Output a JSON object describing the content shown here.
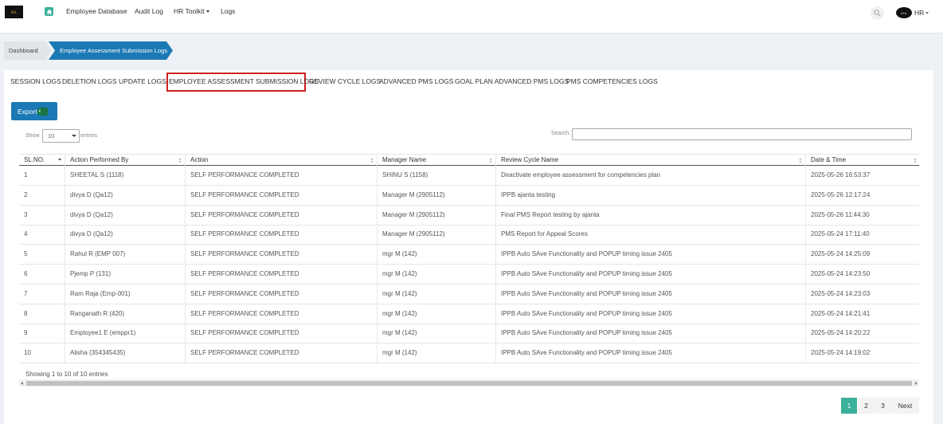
{
  "brand": {
    "logo_text": "EHL"
  },
  "nav": {
    "items": [
      "Employee Database",
      "Audit Log",
      "HR Toolkit",
      "Logs"
    ],
    "user_label": "HR",
    "avatar_text": "EHL"
  },
  "breadcrumb": {
    "home": "Dashboard",
    "current": "Employee Assessment Submission Logs"
  },
  "tabs": [
    "SESSION LOGS",
    "DELETION LOGS",
    "UPDATE LOGS",
    "EMPLOYEE ASSESSMENT SUBMISSION LOGS",
    "REVIEW CYCLE LOGS",
    "ADVANCED PMS LOGS",
    "GOAL PLAN ADVANCED PMS LOGS",
    "PMS COMPETENCIES LOGS"
  ],
  "active_tab": "EMPLOYEE ASSESSMENT SUBMISSION LOGS",
  "controls": {
    "export_label": "Export",
    "excel_badge": "x",
    "show_label": "Show",
    "page_size": "10",
    "entries_label": "entries",
    "search_label": "Search:",
    "search_value": ""
  },
  "table": {
    "columns": [
      "SL.NO.",
      "Action Performed By",
      "Action",
      "Manager Name",
      "Review Cycle Name",
      "Date & Time"
    ],
    "rows": [
      [
        "1",
        "SHEETAL S (1118)",
        "SELF PERFORMANCE COMPLETED",
        "SHINU S (1158)",
        "Deactivate employee assessment for competencies plan",
        "2025-05-26 16:53:37"
      ],
      [
        "2",
        "divya D (Qa12)",
        "SELF PERFORMANCE COMPLETED",
        "Manager M (2905112)",
        "IPPB ajanta testing",
        "2025-05-26 12:17:24"
      ],
      [
        "3",
        "divya D (Qa12)",
        "SELF PERFORMANCE COMPLETED",
        "Manager M (2905112)",
        "Final PMS Report testing by ajanta",
        "2025-05-26 11:44:30"
      ],
      [
        "4",
        "divya D (Qa12)",
        "SELF PERFORMANCE COMPLETED",
        "Manager M (2905112)",
        "PMS Report for Appeal Scores",
        "2025-05-24 17:11:40"
      ],
      [
        "5",
        "Rahul R (EMP 007)",
        "SELF PERFORMANCE COMPLETED",
        "mgr M (142)",
        "IPPB Auto SAve Functionality and POPUP timing issue 2405",
        "2025-05-24 14:25:09"
      ],
      [
        "6",
        "Pjemp P (131)",
        "SELF PERFORMANCE COMPLETED",
        "mgr M (142)",
        "IPPB Auto SAve Functionality and POPUP timing issue 2405",
        "2025-05-24 14:23:50"
      ],
      [
        "7",
        "Ram Raja (Emp-001)",
        "SELF PERFORMANCE COMPLETED",
        "mgr M (142)",
        "IPPB Auto SAve Functionality and POPUP timing issue 2405",
        "2025-05-24 14:23:03"
      ],
      [
        "8",
        "Ranganath R (420)",
        "SELF PERFORMANCE COMPLETED",
        "mgr M (142)",
        "IPPB Auto SAve Functionality and POPUP timing issue 2405",
        "2025-05-24 14:21:41"
      ],
      [
        "9",
        "Employee1 E (emppr1)",
        "SELF PERFORMANCE COMPLETED",
        "mgr M (142)",
        "IPPB Auto SAve Functionality and POPUP timing issue 2405",
        "2025-05-24 14:20:22"
      ],
      [
        "10",
        "Alisha (354345435)",
        "SELF PERFORMANCE COMPLETED",
        "mgr M (142)",
        "IPPB Auto SAve Functionality and POPUP timing issue 2405",
        "2025-05-24 14:19:02"
      ]
    ]
  },
  "footer": {
    "info": "Showing 1 to 10 of 10 entries",
    "pages": [
      "1",
      "2",
      "3"
    ],
    "active_page": "1",
    "next_label": "Next"
  },
  "colors": {
    "primary": "#1b79b5",
    "accent_green": "#3bb09a",
    "highlight_red": "#cc1f1f"
  }
}
